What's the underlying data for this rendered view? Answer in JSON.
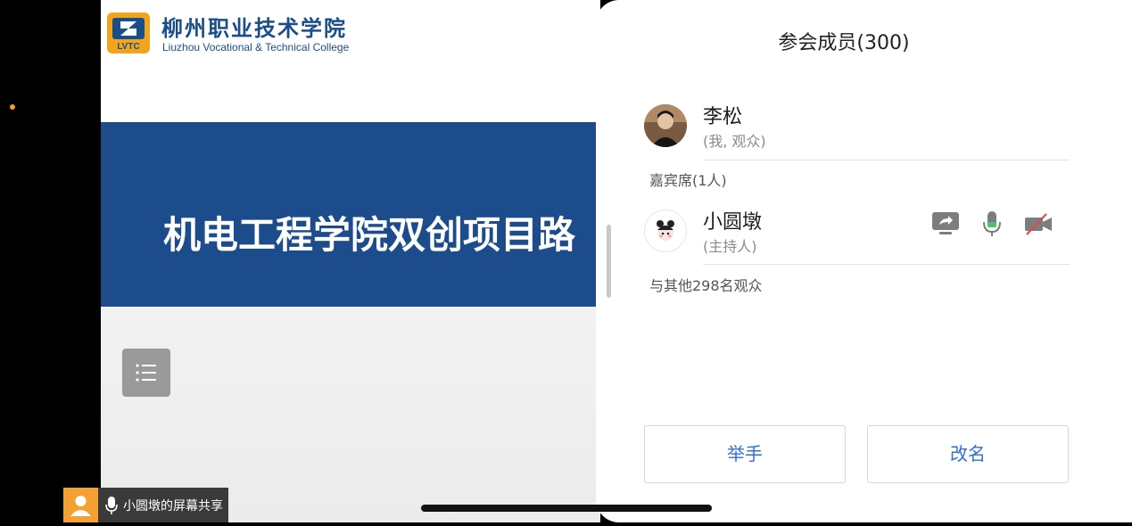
{
  "slide": {
    "logo_text": "LVTC",
    "college_cn": "柳州职业技术学院",
    "college_en": "Liuzhou Vocational & Technical College",
    "title": "机电工程学院双创项目路"
  },
  "status_bar": {
    "label": "小圆墩的屏幕共享",
    "accent_color": "#f5a033"
  },
  "panel": {
    "title": "参会成员(300)",
    "me": {
      "name": "李松",
      "role": "(我, 观众)"
    },
    "guest_section_label": "嘉宾席(1人)",
    "host": {
      "name": "小圆墩",
      "role": "(主持人)",
      "controls": [
        "screen-share-icon",
        "microphone-icon",
        "camera-off-icon"
      ]
    },
    "others_label": "与其他298名观众",
    "raise_hand_label": "举手",
    "rename_label": "改名",
    "button_text_color": "#2f6fd6"
  }
}
